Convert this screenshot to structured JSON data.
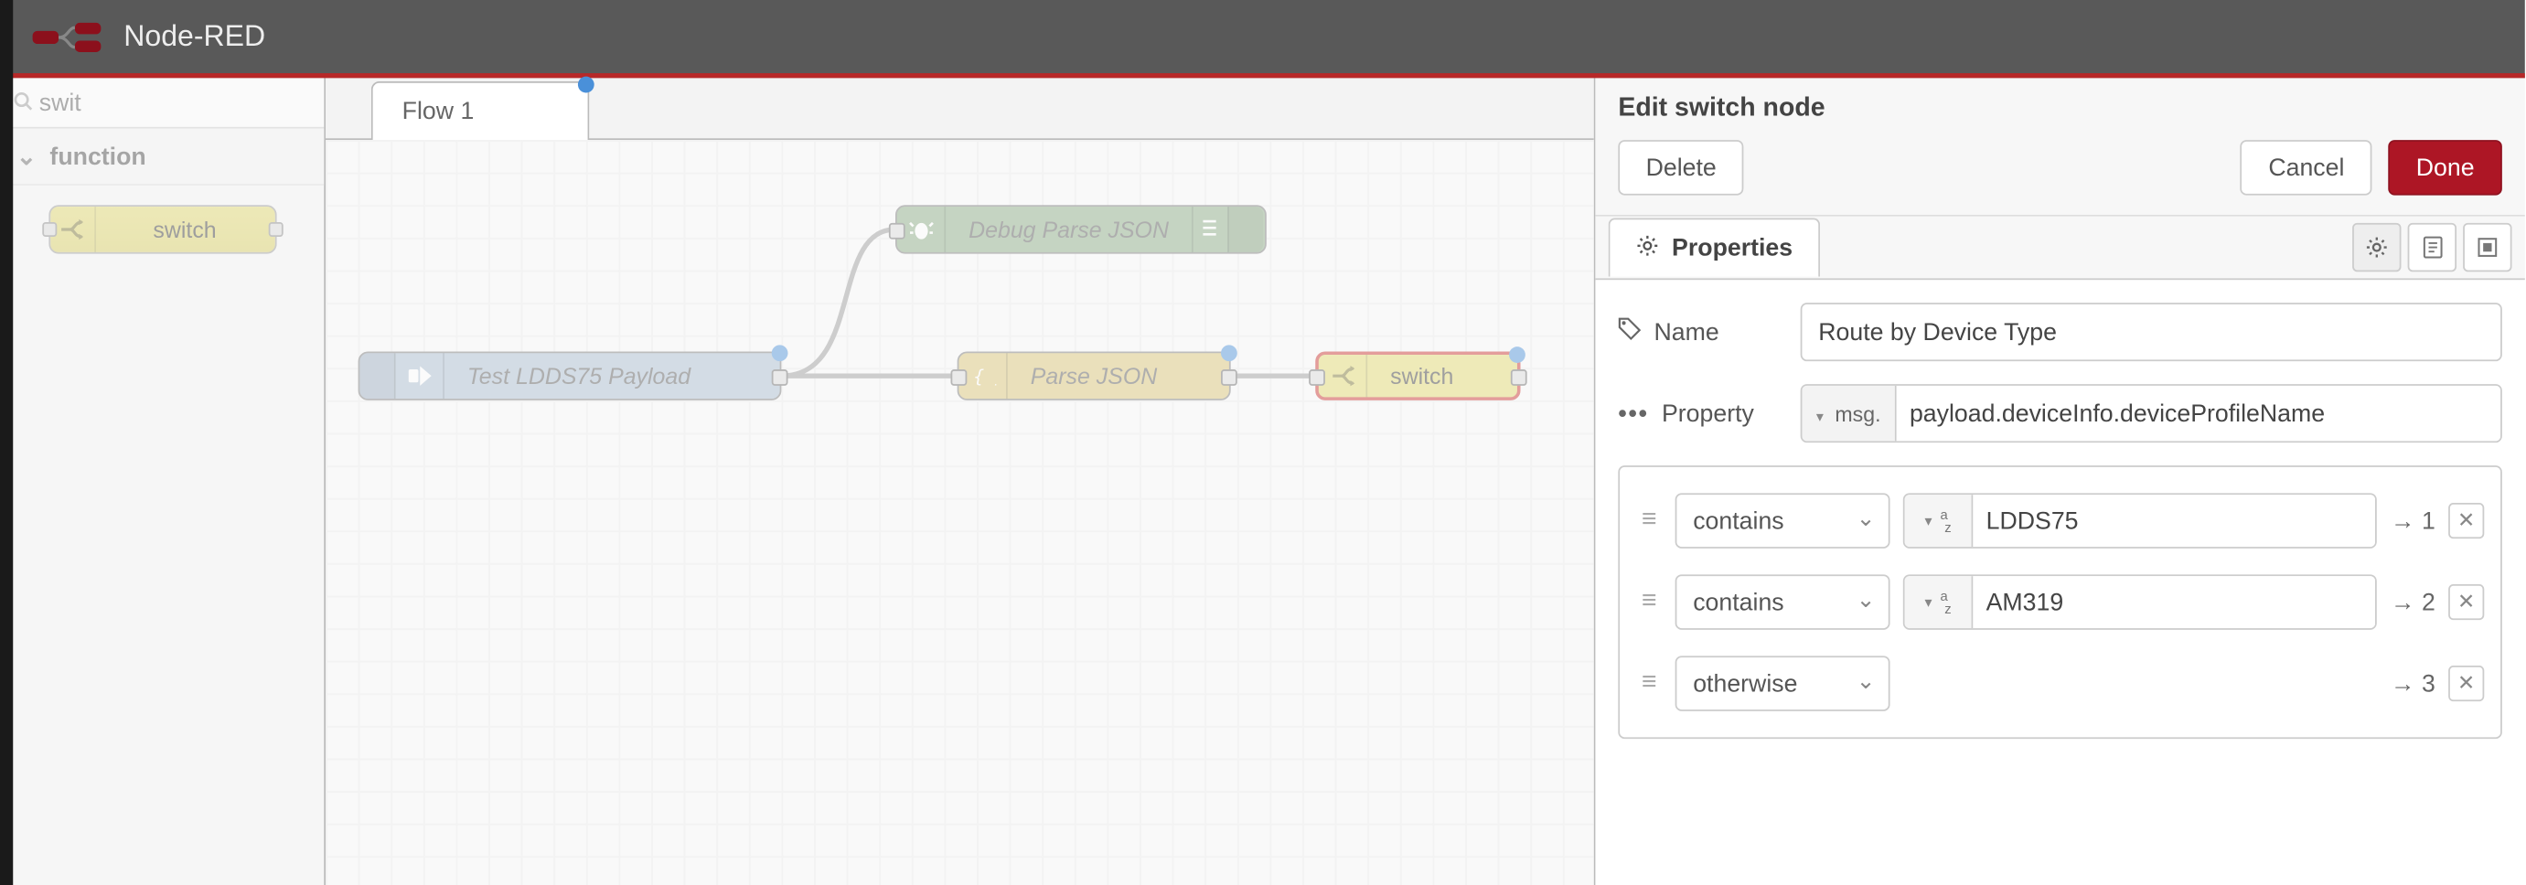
{
  "app": {
    "title": "Node-RED"
  },
  "palette": {
    "search_value": "swit",
    "category": "function",
    "node_label": "switch"
  },
  "tabs": {
    "flow1": "Flow 1"
  },
  "nodes": {
    "inject_label": "Test LDDS75 Payload",
    "json_label": "Parse JSON",
    "debug_label": "Debug Parse JSON",
    "switch_label": "switch"
  },
  "edit": {
    "title": "Edit switch node",
    "delete_btn": "Delete",
    "cancel_btn": "Cancel",
    "done_btn": "Done",
    "tab_properties": "Properties",
    "name_lbl": "Name",
    "name_val": "Route by Device Type",
    "property_lbl": "Property",
    "property_type": "msg.",
    "property_val": "payload.deviceInfo.deviceProfileName",
    "rules": [
      {
        "op": "contains",
        "val": "LDDS75",
        "out": "→ 1"
      },
      {
        "op": "contains",
        "val": "AM319",
        "out": "→ 2"
      },
      {
        "op": "otherwise",
        "val": "",
        "out": "→ 3"
      }
    ]
  }
}
